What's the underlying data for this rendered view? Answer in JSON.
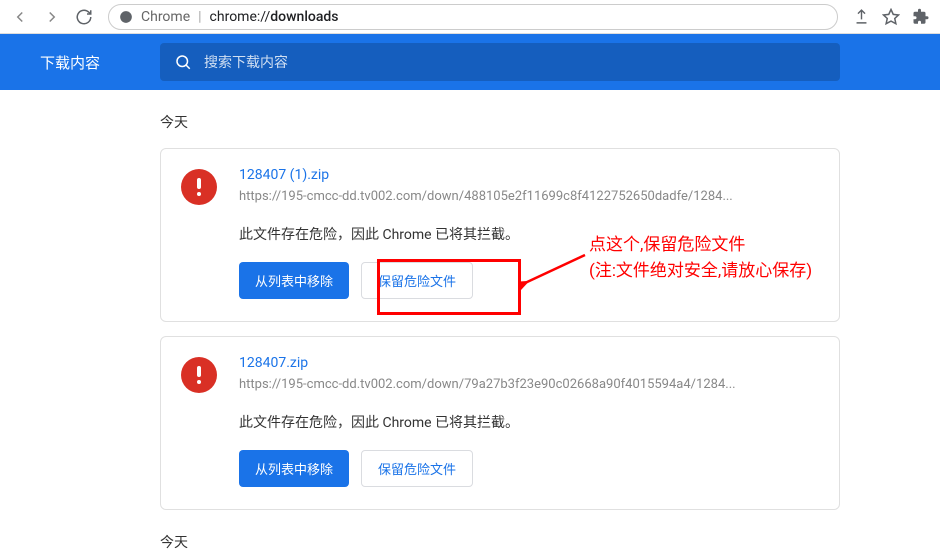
{
  "toolbar": {
    "url_prefix": "Chrome",
    "url_scheme": "chrome://",
    "url_path": "downloads"
  },
  "header": {
    "title": "下载内容",
    "search_placeholder": "搜索下载内容"
  },
  "section_label": "今天",
  "section_label_bottom": "今天",
  "downloads": [
    {
      "filename": "128407 (1).zip",
      "url": "https://195-cmcc-dd.tv002.com/down/488105e2f11699c8f4122752650dadfe/1284...",
      "warning": "此文件存在危险，因此 Chrome 已将其拦截。",
      "remove_label": "从列表中移除",
      "keep_label": "保留危险文件"
    },
    {
      "filename": "128407.zip",
      "url": "https://195-cmcc-dd.tv002.com/down/79a27b3f23e90c02668a90f4015594a4/1284...",
      "warning": "此文件存在危险，因此 Chrome 已将其拦截。",
      "remove_label": "从列表中移除",
      "keep_label": "保留危险文件"
    }
  ],
  "annotation": {
    "line1": "点这个,保留危险文件",
    "line2": "(注:文件绝对安全,请放心保存)"
  }
}
